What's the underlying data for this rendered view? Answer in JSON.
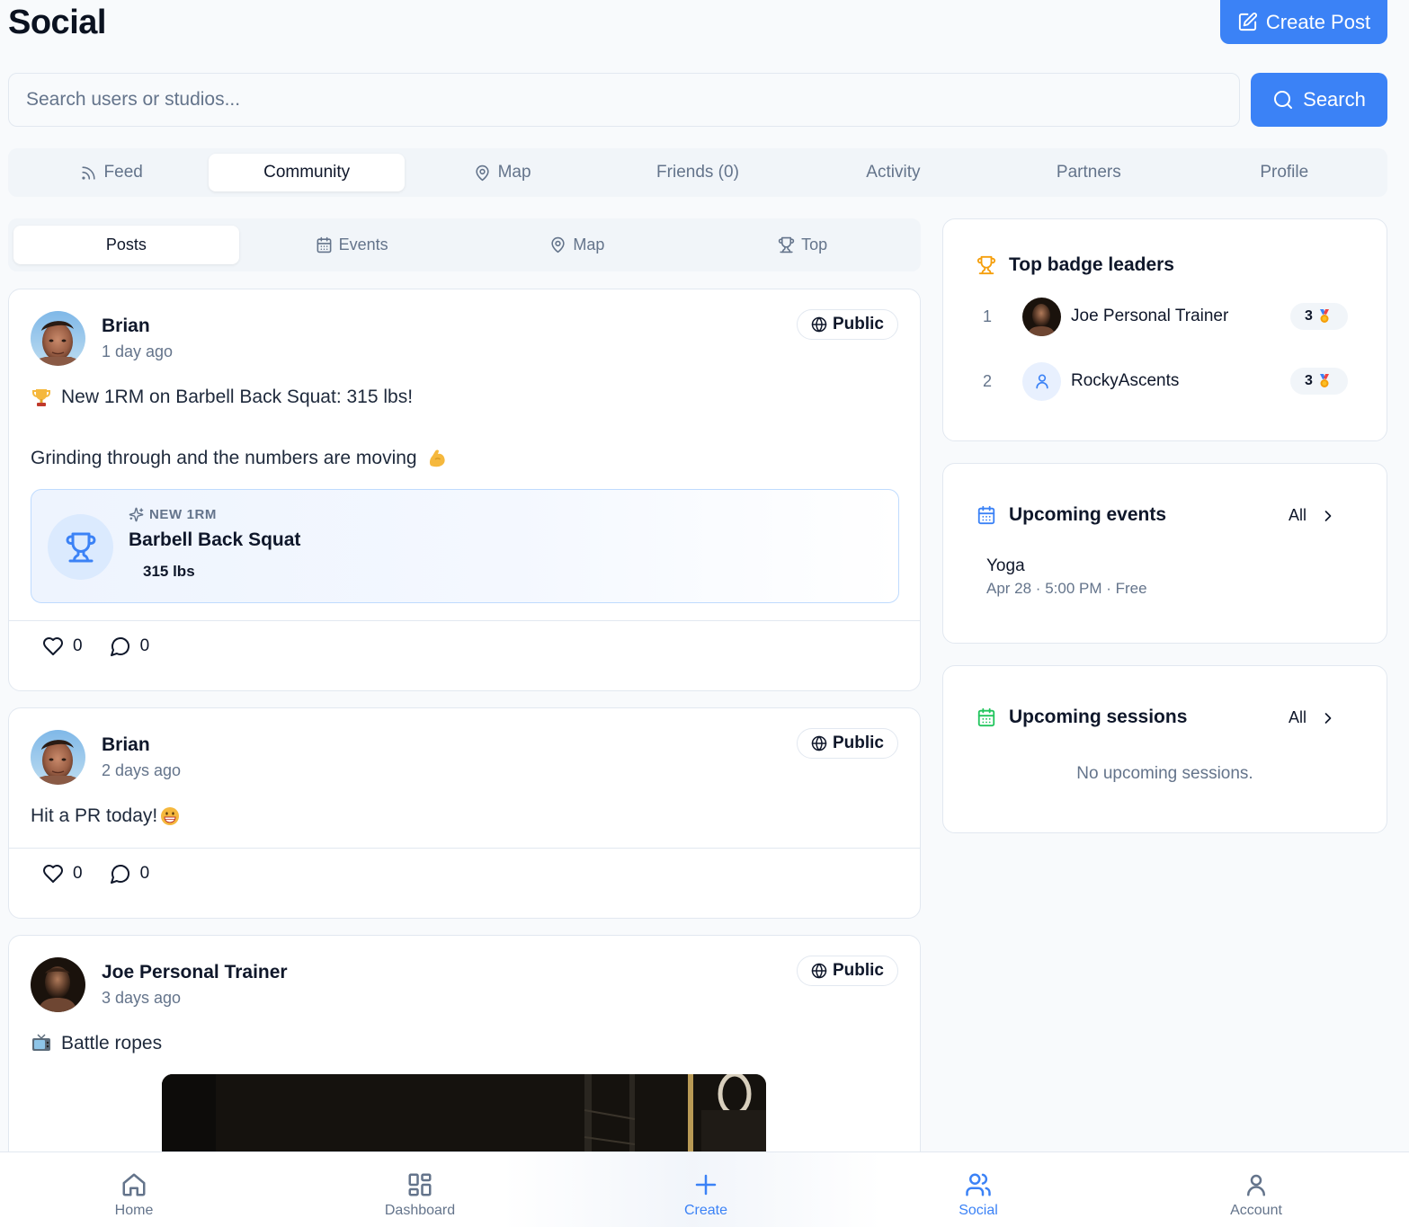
{
  "header": {
    "title": "Social",
    "create_post_label": "Create Post"
  },
  "search": {
    "placeholder": "Search users or studios...",
    "value": "",
    "button_label": "Search"
  },
  "main_tabs": [
    {
      "label": "Feed",
      "icon": "rss-icon",
      "active": false
    },
    {
      "label": "Community",
      "icon": "",
      "active": true
    },
    {
      "label": "Map",
      "icon": "map-pin-icon",
      "active": false
    },
    {
      "label": "Friends (0)",
      "icon": "",
      "active": false
    },
    {
      "label": "Activity",
      "icon": "",
      "active": false
    },
    {
      "label": "Partners",
      "icon": "",
      "active": false
    },
    {
      "label": "Profile",
      "icon": "",
      "active": false
    }
  ],
  "sub_tabs": [
    {
      "label": "Posts",
      "icon": "",
      "active": true
    },
    {
      "label": "Events",
      "icon": "calendar-icon",
      "active": false
    },
    {
      "label": "Map",
      "icon": "map-pin-icon",
      "active": false
    },
    {
      "label": "Top",
      "icon": "trophy-icon",
      "active": false
    }
  ],
  "posts": [
    {
      "author": "Brian",
      "time": "1 day ago",
      "visibility": "Public",
      "line1_icon": "trophy-emoji",
      "line1": "New 1RM on Barbell Back Squat: 315 lbs!",
      "line2": "Grinding through and the numbers are moving",
      "line2_emoji": "flexed-biceps-emoji",
      "pr": {
        "tag": "NEW 1RM",
        "exercise": "Barbell Back Squat",
        "value": "315 lbs"
      },
      "likes": "0",
      "comments": "0"
    },
    {
      "author": "Brian",
      "time": "2 days ago",
      "visibility": "Public",
      "line1": "Hit a PR today!",
      "line1_emoji": "grinning-emoji",
      "likes": "0",
      "comments": "0"
    },
    {
      "author": "Joe Personal Trainer",
      "time": "3 days ago",
      "visibility": "Public",
      "line1_icon": "television-emoji",
      "line1": "Battle ropes"
    }
  ],
  "badge_leaders": {
    "title": "Top badge leaders",
    "entries": [
      {
        "rank": "1",
        "name": "Joe Personal Trainer",
        "count": "3"
      },
      {
        "rank": "2",
        "name": "RockyAscents",
        "count": "3"
      }
    ]
  },
  "upcoming_events": {
    "title": "Upcoming events",
    "all_label": "All",
    "items": [
      {
        "name": "Yoga",
        "meta": "Apr 28 · 5:00 PM · Free"
      }
    ]
  },
  "upcoming_sessions": {
    "title": "Upcoming sessions",
    "all_label": "All",
    "empty_text": "No upcoming sessions."
  },
  "bottom_nav": [
    {
      "label": "Home",
      "icon": "home-icon"
    },
    {
      "label": "Dashboard",
      "icon": "dashboard-icon"
    },
    {
      "label": "Create",
      "icon": "plus-icon"
    },
    {
      "label": "Social",
      "icon": "users-icon"
    },
    {
      "label": "Account",
      "icon": "user-icon"
    }
  ],
  "colors": {
    "primary": "#3b82f6",
    "background": "#f8fafc",
    "muted_text": "#64748b",
    "trophy_gold": "#f59e0b",
    "sessions_green": "#22c55e"
  }
}
